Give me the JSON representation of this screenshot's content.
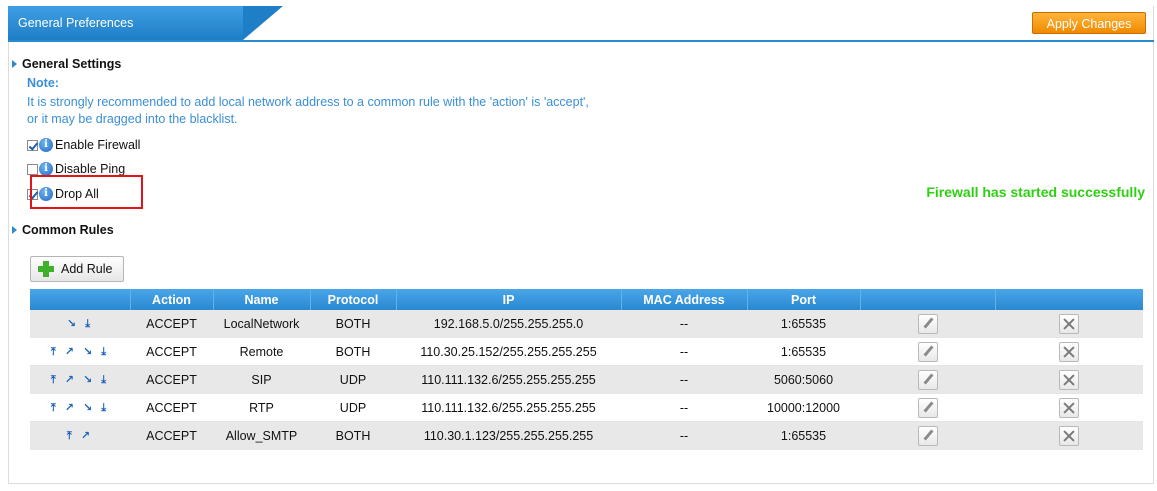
{
  "header": {
    "tab_label": "General Preferences",
    "apply_label": "Apply Changes"
  },
  "general": {
    "title": "General Settings",
    "note_label": "Note:",
    "note_line1": "It is strongly recommended to add local network address to a common rule with the 'action' is 'accept',",
    "note_line2": "or it may be dragged into the blacklist.",
    "options": [
      {
        "label": "Enable Firewall",
        "checked": true
      },
      {
        "label": "Disable Ping",
        "checked": false
      },
      {
        "label": "Drop All",
        "checked": true
      }
    ],
    "status": "Firewall has started successfully"
  },
  "common_rules": {
    "title": "Common Rules",
    "add_label": "Add Rule",
    "columns": [
      "",
      "Action",
      "Name",
      "Protocol",
      "IP",
      "MAC Address",
      "Port",
      "",
      ""
    ],
    "rows": [
      {
        "arrows": "↘ ⤓",
        "action": "ACCEPT",
        "name": "LocalNetwork",
        "protocol": "BOTH",
        "ip": "192.168.5.0/255.255.255.0",
        "mac": "--",
        "port": "1:65535"
      },
      {
        "arrows": "⤒ ↗ ↘ ⤓",
        "action": "ACCEPT",
        "name": "Remote",
        "protocol": "BOTH",
        "ip": "110.30.25.152/255.255.255.255",
        "mac": "--",
        "port": "1:65535"
      },
      {
        "arrows": "⤒ ↗ ↘ ⤓",
        "action": "ACCEPT",
        "name": "SIP",
        "protocol": "UDP",
        "ip": "110.111.132.6/255.255.255.255",
        "mac": "--",
        "port": "5060:5060"
      },
      {
        "arrows": "⤒ ↗ ↘ ⤓",
        "action": "ACCEPT",
        "name": "RTP",
        "protocol": "UDP",
        "ip": "110.111.132.6/255.255.255.255",
        "mac": "--",
        "port": "10000:12000"
      },
      {
        "arrows": "⤒ ↗",
        "action": "ACCEPT",
        "name": "Allow_SMTP",
        "protocol": "BOTH",
        "ip": "110.30.1.123/255.255.255.255",
        "mac": "--",
        "port": "1:65535"
      }
    ]
  },
  "icons": {
    "edit": "edit-pencil-icon",
    "delete": "delete-x-icon",
    "add": "plus-icon",
    "info": "info-icon"
  },
  "colors": {
    "accent": "#2a8ccf",
    "apply": "#f08a00",
    "status": "#2fcf14",
    "highlight": "#e0141c",
    "note": "#3a8fd8"
  }
}
